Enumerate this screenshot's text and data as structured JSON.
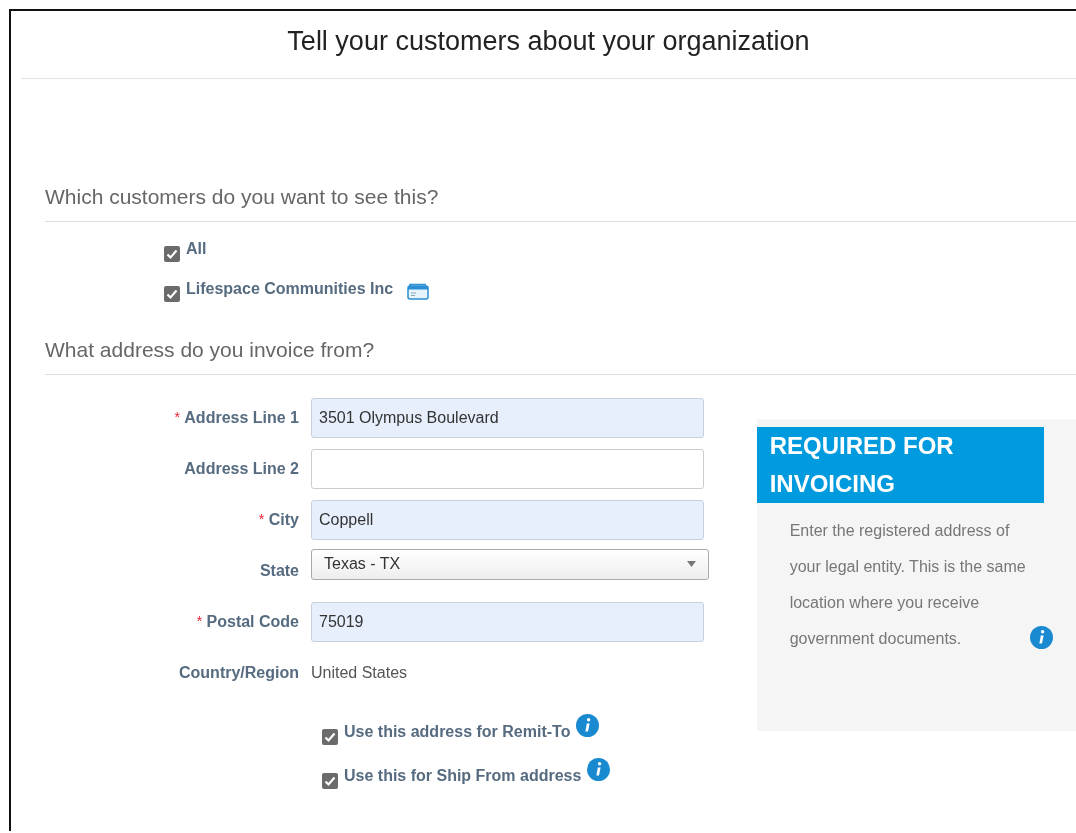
{
  "title": "Tell your customers about your organization",
  "customers_section": {
    "heading": "Which customers do you want to see this?",
    "options": [
      {
        "label": "All",
        "checked": true
      },
      {
        "label": "Lifespace Communities Inc",
        "checked": true,
        "card_icon": true
      }
    ]
  },
  "address_section": {
    "heading": "What address do you invoice from?",
    "fields": [
      {
        "kind": "text",
        "label": "Address Line 1",
        "required_mark": "*",
        "value": "3501 Olympus Boulevard",
        "filled": true
      },
      {
        "kind": "text",
        "label": "Address Line 2",
        "filled": false
      },
      {
        "kind": "text",
        "label": "City",
        "required_mark": "*",
        "value": "Coppell",
        "filled": true
      },
      {
        "kind": "select",
        "label": "State",
        "value": "Texas - TX"
      },
      {
        "kind": "text",
        "label": "Postal Code",
        "required_mark": "*",
        "value": "75019",
        "filled": true
      },
      {
        "kind": "static",
        "label": "Country/Region",
        "value": "United States"
      }
    ],
    "options": [
      {
        "label": "Use this address for Remit-To",
        "checked": true
      },
      {
        "label": "Use this for Ship From address",
        "checked": true
      }
    ]
  },
  "help_panel": {
    "heading": "REQUIRED FOR INVOICING",
    "text": "Enter the registered address of your legal entity. This is the same location where you receive government documents."
  }
}
